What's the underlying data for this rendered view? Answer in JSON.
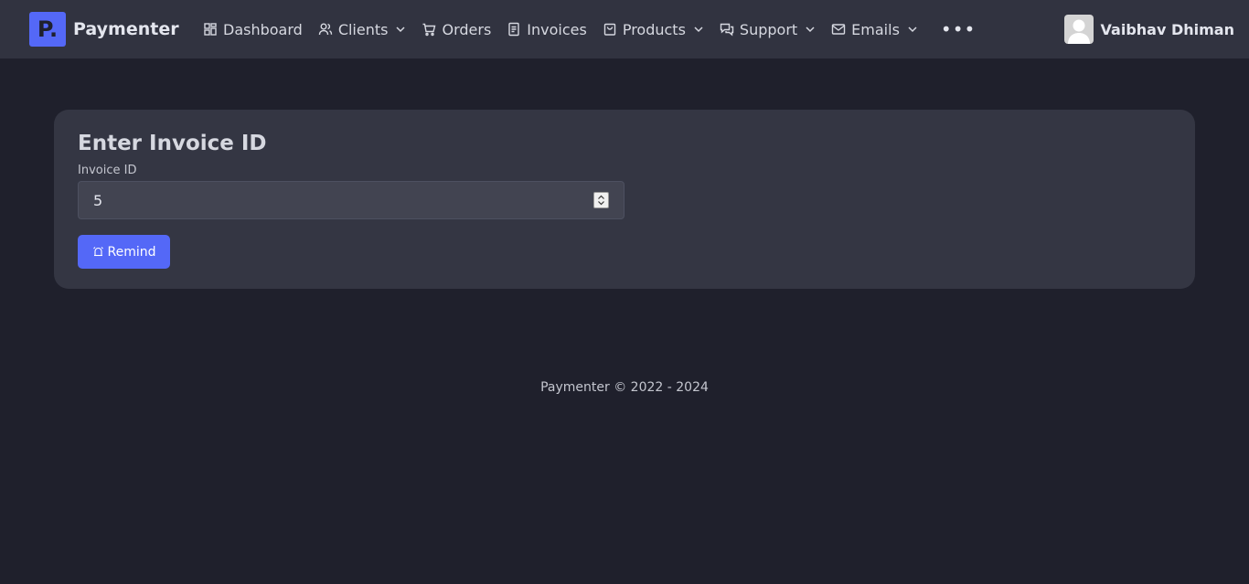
{
  "brand": {
    "logo_text": "P.",
    "name": "Paymenter"
  },
  "nav": {
    "items": [
      {
        "label": "Dashboard",
        "icon": "grid-icon",
        "dropdown": false
      },
      {
        "label": "Clients",
        "icon": "users-icon",
        "dropdown": true
      },
      {
        "label": "Orders",
        "icon": "cart-icon",
        "dropdown": false
      },
      {
        "label": "Invoices",
        "icon": "document-icon",
        "dropdown": false
      },
      {
        "label": "Products",
        "icon": "bag-icon",
        "dropdown": true
      },
      {
        "label": "Support",
        "icon": "chat-icon",
        "dropdown": true
      },
      {
        "label": "Emails",
        "icon": "mail-icon",
        "dropdown": true
      }
    ],
    "more_label": "•••"
  },
  "user": {
    "name": "Vaibhav Dhiman"
  },
  "card": {
    "title": "Enter Invoice ID",
    "field_label": "Invoice ID",
    "field_value": "5",
    "button_label": "Remind",
    "button_icon": "bell-icon"
  },
  "footer": {
    "text": "Paymenter © 2022 - 2024"
  },
  "colors": {
    "accent": "#5468f7",
    "background": "#1f202c",
    "navbar": "#313340",
    "card": "#343643"
  }
}
